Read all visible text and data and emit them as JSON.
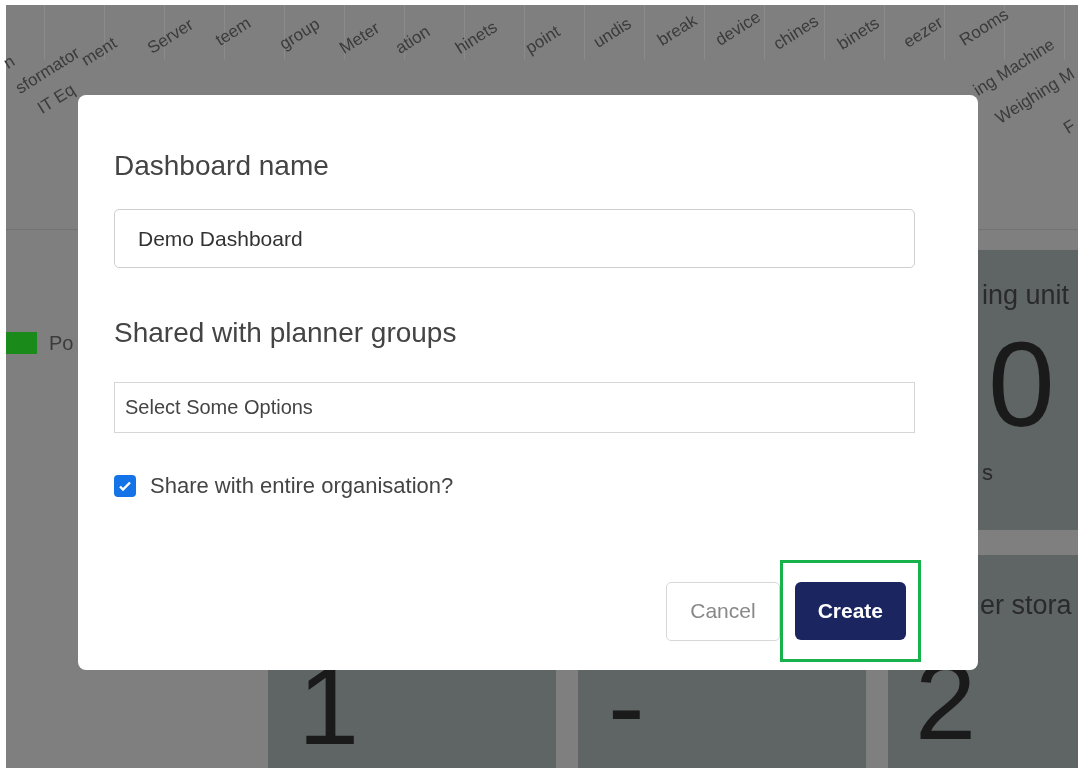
{
  "chart_axis_labels": [
    "n",
    "sformator",
    "IT Eq",
    "ment",
    "Server",
    "teem",
    "group",
    "Meter",
    "ation",
    "hinets",
    "point",
    "undis",
    "break",
    "device",
    "chines",
    "binets",
    "eezer",
    "Rooms",
    "ing Machine",
    "Weighing M",
    "F"
  ],
  "legend": {
    "label": "Po"
  },
  "cards_top": [
    {
      "title": "ing unit",
      "value": "0",
      "footnote": "s"
    }
  ],
  "cards_bottom": [
    {
      "value": "1"
    },
    {
      "value": "-"
    },
    {
      "title": "er stora",
      "value": "2"
    }
  ],
  "dialog": {
    "name_label": "Dashboard name",
    "name_value": "Demo Dashboard",
    "groups_label": "Shared with planner groups",
    "groups_placeholder": "Select Some Options",
    "share_all": {
      "label": "Share with entire organisation?",
      "checked": true
    },
    "buttons": [
      {
        "label": "Cancel",
        "kind": "secondary",
        "highlighted": false
      },
      {
        "label": "Create",
        "kind": "primary",
        "highlighted": true
      }
    ]
  }
}
